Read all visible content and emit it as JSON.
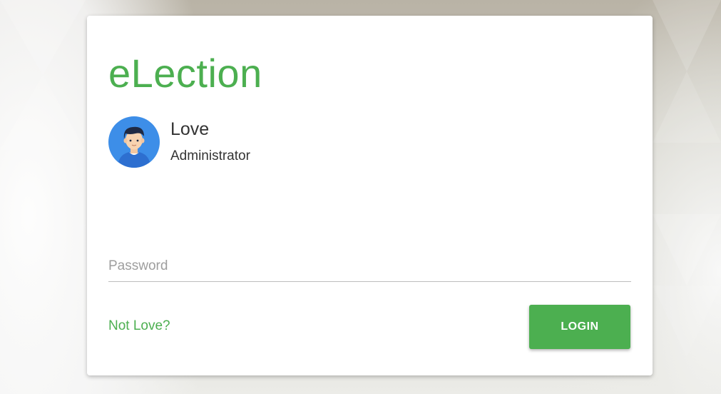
{
  "brand": {
    "title": "eLection",
    "color": "#4caf50"
  },
  "user": {
    "name": "Love",
    "role": "Administrator",
    "avatar_icon": "user-avatar-icon"
  },
  "password": {
    "placeholder": "Password",
    "value": ""
  },
  "switch_user_link": "Not Love?",
  "login_button": "LOGIN",
  "colors": {
    "accent": "#4caf50",
    "avatar_bg": "#3d8ee8"
  }
}
